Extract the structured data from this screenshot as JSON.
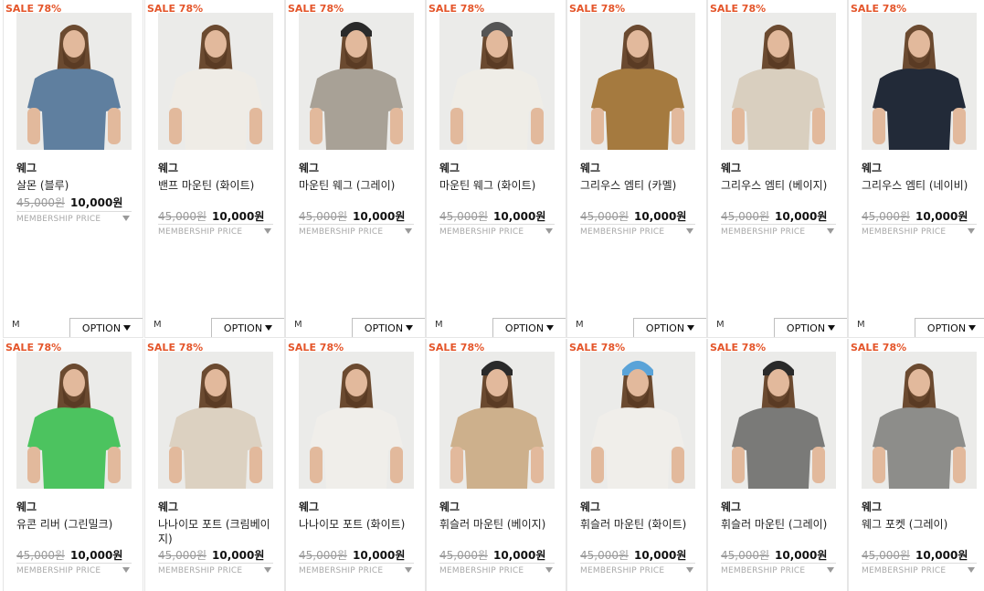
{
  "sale_label": "SALE 78%",
  "brand": "웨그",
  "original_price": "45,000원",
  "sale_price": "10,000원",
  "membership_label": "MEMBERSHIP PRICE",
  "size_label": "M",
  "option_label": "OPTION",
  "colors": {
    "sale_badge": "#e4552a",
    "text": "#222222",
    "muted": "#999999"
  },
  "products": [
    {
      "name": "살몬 (블루)",
      "shirt": "#5f7f9f",
      "hat": ""
    },
    {
      "name": "밴프 마운틴 (화이트)",
      "shirt": "#efece6",
      "hat": ""
    },
    {
      "name": "마운틴 웨그 (그레이)",
      "shirt": "#a8a196",
      "hat": "#2a2a2a"
    },
    {
      "name": "마운틴 웨그 (화이트)",
      "shirt": "#efede7",
      "hat": "#555555"
    },
    {
      "name": "그리우스 엠티 (카멜)",
      "shirt": "#a57a3f",
      "hat": ""
    },
    {
      "name": "그리우스 엠티 (베이지)",
      "shirt": "#d9cfbf",
      "hat": ""
    },
    {
      "name": "그리우스 엠티 (네이비)",
      "shirt": "#222a38",
      "hat": ""
    },
    {
      "name": "유콘 리버 (그린밀크)",
      "shirt": "#4cc35f",
      "hat": ""
    },
    {
      "name": "나나이모 포트 (크림베이지)",
      "shirt": "#dcd1c1",
      "hat": ""
    },
    {
      "name": "나나이모 포트 (화이트)",
      "shirt": "#f0eeea",
      "hat": ""
    },
    {
      "name": "휘슬러 마운틴 (베이지)",
      "shirt": "#cdb08c",
      "hat": "#2a2a2a"
    },
    {
      "name": "휘슬러 마운틴 (화이트)",
      "shirt": "#f0eeea",
      "hat": "#5aa3d8"
    },
    {
      "name": "휘슬러 마운틴 (그레이)",
      "shirt": "#7a7a78",
      "hat": "#2a2a2a"
    },
    {
      "name": "웨그 포켓 (그레이)",
      "shirt": "#8d8d8a",
      "hat": ""
    }
  ]
}
